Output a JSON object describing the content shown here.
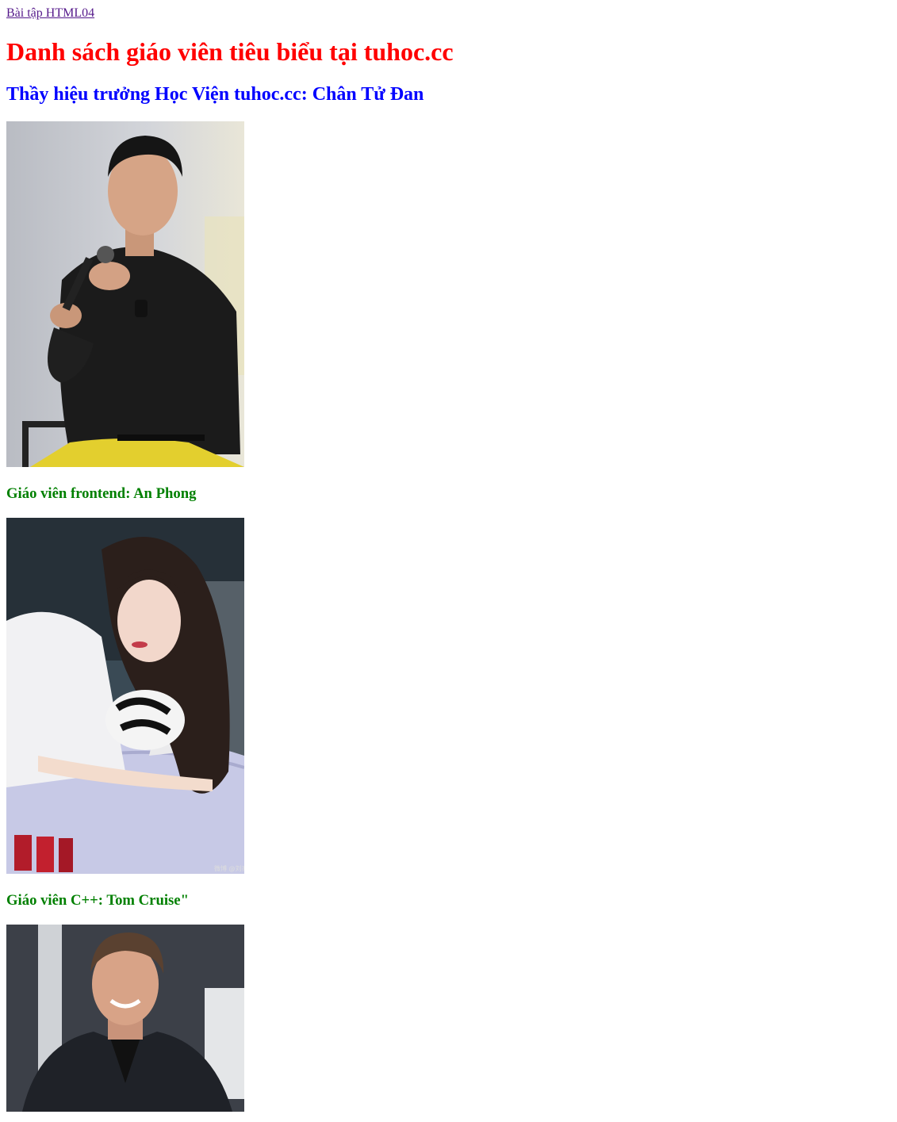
{
  "nav": {
    "link_text": "Bài tập HTML04"
  },
  "page": {
    "title": "Danh sách giáo viên tiêu biểu tại tuhoc.cc",
    "principal_heading": "Thầy hiệu trưởng Học Viện tuhoc.cc: Chân Tử Đan"
  },
  "teachers": [
    {
      "heading": "Giáo viên frontend: An Phong"
    },
    {
      "heading": "Giáo viên C++: Tom Cruise\""
    }
  ],
  "photos": {
    "principal": {
      "icon": "photo-man-microphone"
    },
    "frontend": {
      "icon": "photo-woman-car",
      "watermark": "微博 @刘亦菲"
    },
    "cpp": {
      "icon": "photo-man-suit"
    }
  },
  "colors": {
    "title": "#ff0000",
    "subtitle": "#0000ff",
    "teacher_heading": "#008000",
    "link": "#551a8b"
  }
}
